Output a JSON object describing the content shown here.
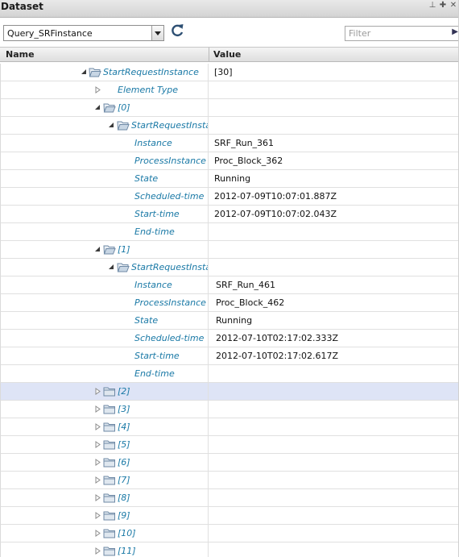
{
  "panel": {
    "title": "Dataset",
    "icons": [
      "pin-icon",
      "maximize-icon",
      "close-icon"
    ]
  },
  "toolbar": {
    "query_select_value": "Query_SRFinstance",
    "filter_placeholder": "Filter"
  },
  "columns": {
    "name": "Name",
    "value": "Value"
  },
  "colors": {
    "node_text": "#1a79a6",
    "selected_row": "#dee4f6",
    "folder": "#8ea8c0"
  },
  "rows": [
    {
      "label": "StartRequestInstance",
      "value": "[30]",
      "depth": 0,
      "kind": "folder",
      "toggle": "expanded"
    },
    {
      "label": "Element Type",
      "value": "",
      "depth": 1,
      "kind": "leaf",
      "toggle": "collapsed"
    },
    {
      "label": "[0]",
      "value": "",
      "depth": 1,
      "kind": "folder",
      "toggle": "expanded"
    },
    {
      "label": "StartRequestInstance",
      "value": "",
      "depth": 2,
      "kind": "folder",
      "toggle": "expanded"
    },
    {
      "label": "Instance",
      "value": "SRF_Run_361",
      "depth": 3,
      "kind": "leaf",
      "toggle": "none"
    },
    {
      "label": "ProcessInstance",
      "value": "Proc_Block_362",
      "depth": 3,
      "kind": "leaf",
      "toggle": "none"
    },
    {
      "label": "State",
      "value": "Running",
      "depth": 3,
      "kind": "leaf",
      "toggle": "none"
    },
    {
      "label": "Scheduled-time",
      "value": "2012-07-09T10:07:01.887Z",
      "depth": 3,
      "kind": "leaf",
      "toggle": "none"
    },
    {
      "label": "Start-time",
      "value": "2012-07-09T10:07:02.043Z",
      "depth": 3,
      "kind": "leaf",
      "toggle": "none"
    },
    {
      "label": "End-time",
      "value": "",
      "depth": 3,
      "kind": "leaf",
      "toggle": "none"
    },
    {
      "label": "[1]",
      "value": "",
      "depth": 1,
      "kind": "folder",
      "toggle": "expanded"
    },
    {
      "label": "StartRequestInstance",
      "value": "",
      "depth": 2,
      "kind": "folder",
      "toggle": "expanded"
    },
    {
      "label": "Instance",
      "value": "SRF_Run_461",
      "depth": 3,
      "kind": "leaf",
      "toggle": "none"
    },
    {
      "label": "ProcessInstance",
      "value": "Proc_Block_462",
      "depth": 3,
      "kind": "leaf",
      "toggle": "none"
    },
    {
      "label": "State",
      "value": "Running",
      "depth": 3,
      "kind": "leaf",
      "toggle": "none"
    },
    {
      "label": "Scheduled-time",
      "value": "2012-07-10T02:17:02.333Z",
      "depth": 3,
      "kind": "leaf",
      "toggle": "none"
    },
    {
      "label": "Start-time",
      "value": "2012-07-10T02:17:02.617Z",
      "depth": 3,
      "kind": "leaf",
      "toggle": "none"
    },
    {
      "label": "End-time",
      "value": "",
      "depth": 3,
      "kind": "leaf",
      "toggle": "none"
    },
    {
      "label": "[2]",
      "value": "",
      "depth": 1,
      "kind": "folder",
      "toggle": "collapsed",
      "selected": true
    },
    {
      "label": "[3]",
      "value": "",
      "depth": 1,
      "kind": "folder",
      "toggle": "collapsed"
    },
    {
      "label": "[4]",
      "value": "",
      "depth": 1,
      "kind": "folder",
      "toggle": "collapsed"
    },
    {
      "label": "[5]",
      "value": "",
      "depth": 1,
      "kind": "folder",
      "toggle": "collapsed"
    },
    {
      "label": "[6]",
      "value": "",
      "depth": 1,
      "kind": "folder",
      "toggle": "collapsed"
    },
    {
      "label": "[7]",
      "value": "",
      "depth": 1,
      "kind": "folder",
      "toggle": "collapsed"
    },
    {
      "label": "[8]",
      "value": "",
      "depth": 1,
      "kind": "folder",
      "toggle": "collapsed"
    },
    {
      "label": "[9]",
      "value": "",
      "depth": 1,
      "kind": "folder",
      "toggle": "collapsed"
    },
    {
      "label": "[10]",
      "value": "",
      "depth": 1,
      "kind": "folder",
      "toggle": "collapsed"
    },
    {
      "label": "[11]",
      "value": "",
      "depth": 1,
      "kind": "folder",
      "toggle": "collapsed"
    }
  ]
}
